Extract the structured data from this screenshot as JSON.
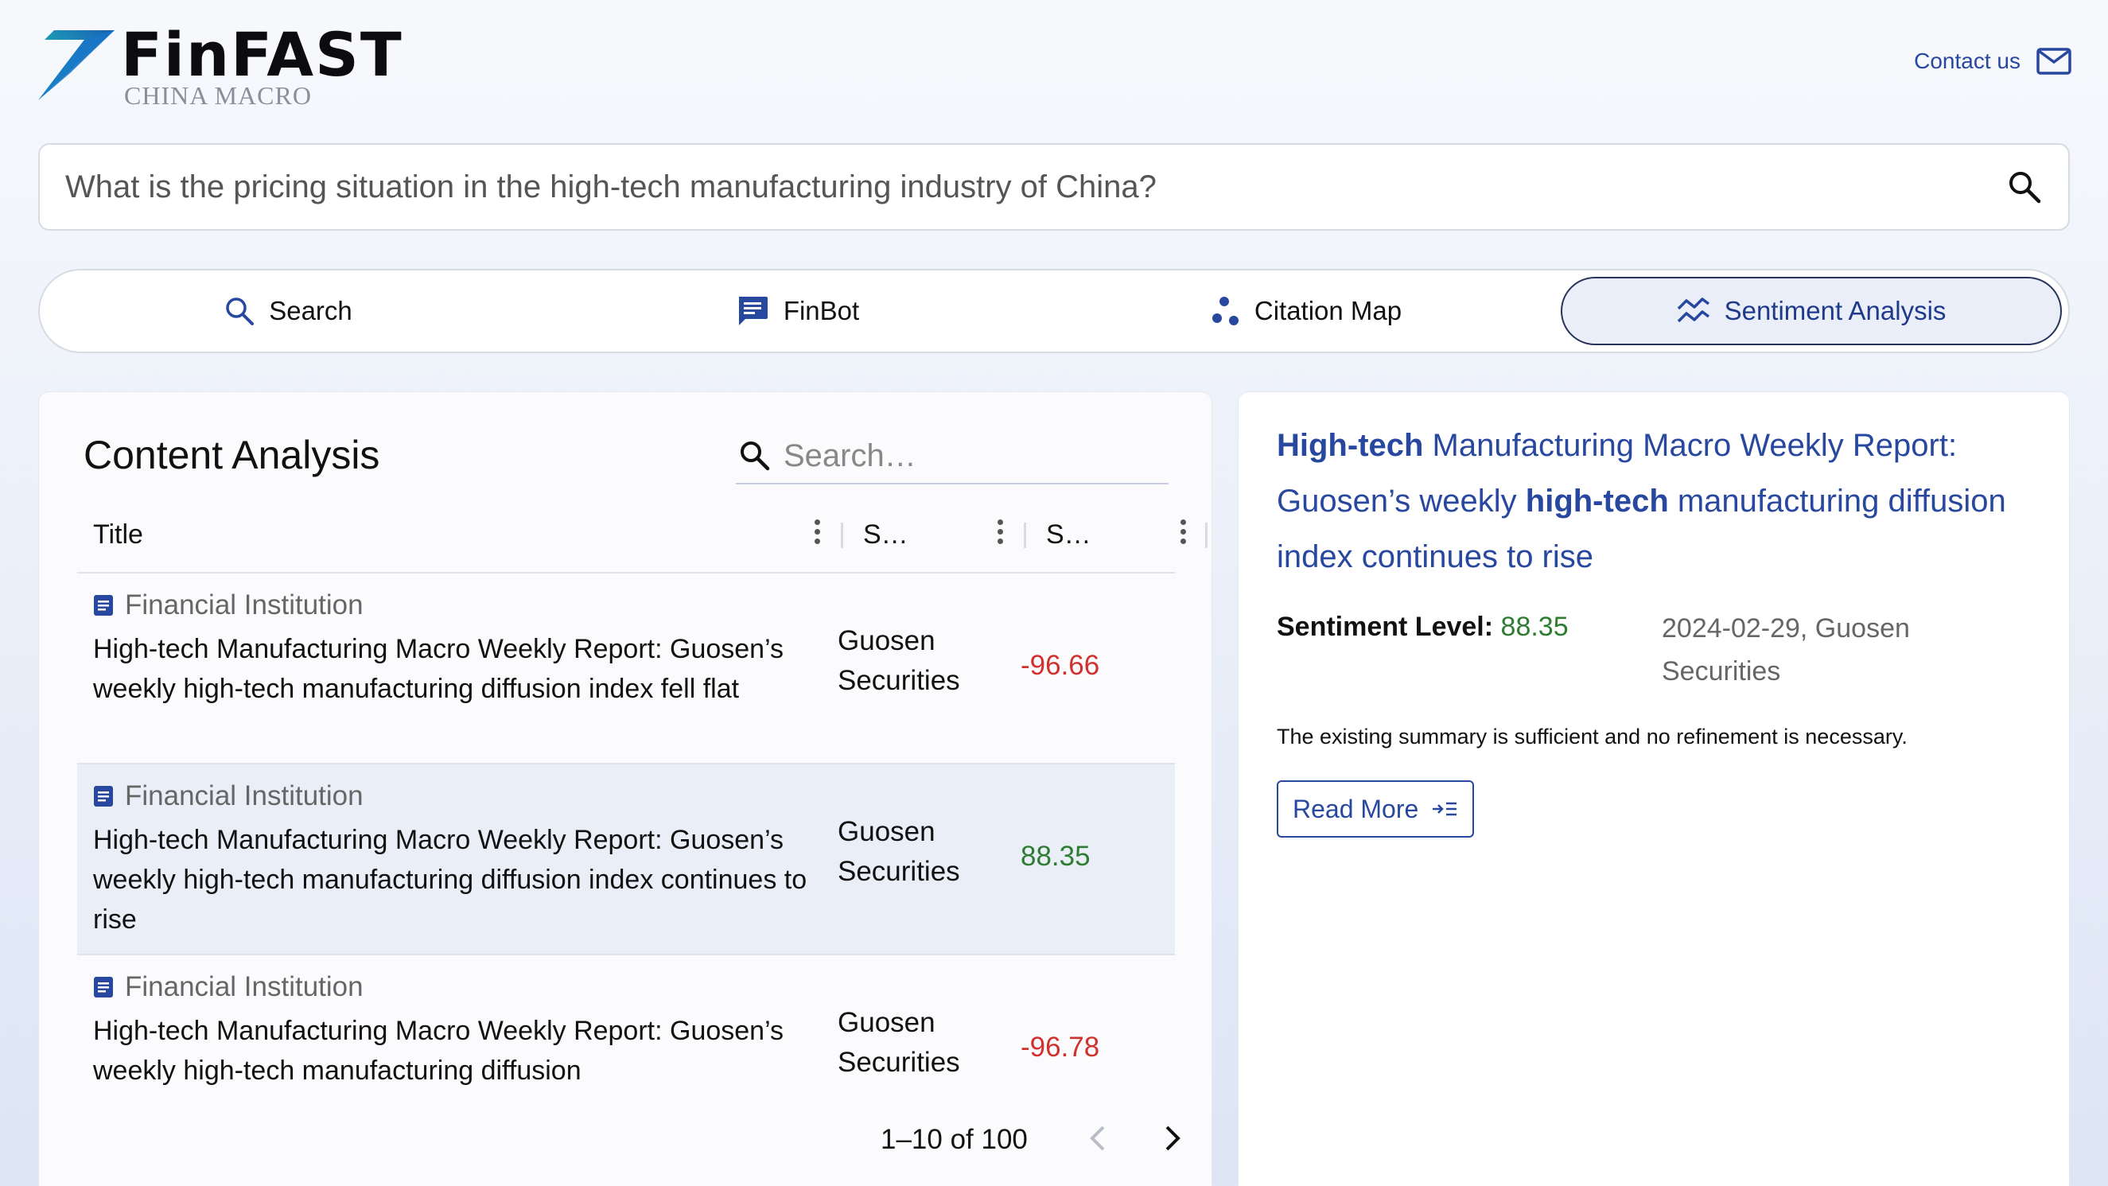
{
  "brand": {
    "name": "FinFAST",
    "subtitle": "CHINA MACRO"
  },
  "header": {
    "contact_label": "Contact us"
  },
  "query": {
    "value": "What is the pricing situation in the high-tech manufacturing industry of China?"
  },
  "tabs": [
    {
      "label": "Search",
      "icon": "search-icon"
    },
    {
      "label": "FinBot",
      "icon": "chat-icon"
    },
    {
      "label": "Citation Map",
      "icon": "graph-icon"
    },
    {
      "label": "Sentiment Analysis",
      "icon": "sentiment-icon",
      "active": true
    }
  ],
  "content_analysis": {
    "title": "Content Analysis",
    "search_placeholder": "Search…",
    "columns": [
      "Title",
      "S…",
      "S…"
    ],
    "rows": [
      {
        "category": "Financial Institution",
        "title": "High-tech Manufacturing Macro Weekly Report: Guosen’s weekly high-tech manufacturing diffusion index fell flat",
        "source": "Guosen Securities",
        "score": "-96.66"
      },
      {
        "category": "Financial Institution",
        "title": "High-tech Manufacturing Macro Weekly Report: Guosen’s weekly high-tech manufacturing diffusion index continues to rise",
        "source": "Guosen Securities",
        "score": "88.35"
      },
      {
        "category": "Financial Institution",
        "title": "High-tech Manufacturing Macro Weekly Report: Guosen’s weekly high-tech manufacturing diffusion",
        "source": "Guosen Securities",
        "score": "-96.78"
      }
    ],
    "pagination": {
      "range": "1–10 of 100"
    }
  },
  "detail": {
    "title_parts": [
      {
        "text": "High-tech",
        "bold": true
      },
      {
        "text": " Manufacturing Macro Weekly Report: Guosen’s weekly ",
        "bold": false
      },
      {
        "text": "high-tech",
        "bold": true
      },
      {
        "text": " manufacturing diffusion index continues to rise",
        "bold": false
      }
    ],
    "sentiment_label": "Sentiment Level:",
    "sentiment_value": "88.35",
    "meta": "2024-02-29, Guosen Securities",
    "summary": "The existing summary is sufficient and no refinement is necessary.",
    "read_more_label": "Read More"
  },
  "colors": {
    "accent": "#2848a0",
    "positive": "#2e7d32",
    "negative": "#d0312d"
  }
}
